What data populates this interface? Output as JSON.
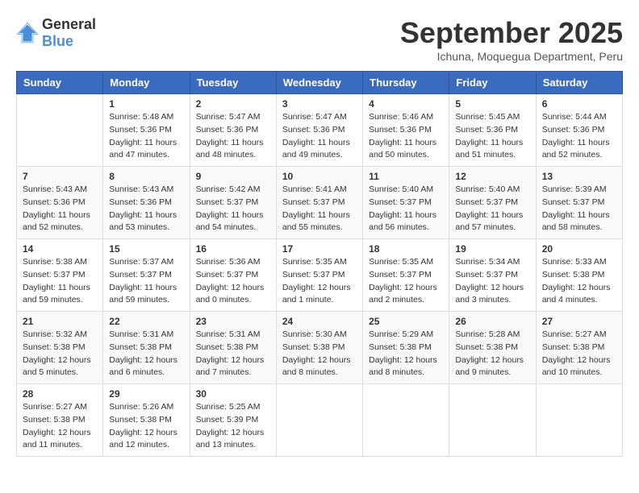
{
  "logo": {
    "general": "General",
    "blue": "Blue"
  },
  "title": {
    "month": "September 2025",
    "location": "Ichuna, Moquegua Department, Peru"
  },
  "weekdays": [
    "Sunday",
    "Monday",
    "Tuesday",
    "Wednesday",
    "Thursday",
    "Friday",
    "Saturday"
  ],
  "weeks": [
    [
      {
        "day": "",
        "sunrise": "",
        "sunset": "",
        "daylight": ""
      },
      {
        "day": "1",
        "sunrise": "Sunrise: 5:48 AM",
        "sunset": "Sunset: 5:36 PM",
        "daylight": "Daylight: 11 hours and 47 minutes."
      },
      {
        "day": "2",
        "sunrise": "Sunrise: 5:47 AM",
        "sunset": "Sunset: 5:36 PM",
        "daylight": "Daylight: 11 hours and 48 minutes."
      },
      {
        "day": "3",
        "sunrise": "Sunrise: 5:47 AM",
        "sunset": "Sunset: 5:36 PM",
        "daylight": "Daylight: 11 hours and 49 minutes."
      },
      {
        "day": "4",
        "sunrise": "Sunrise: 5:46 AM",
        "sunset": "Sunset: 5:36 PM",
        "daylight": "Daylight: 11 hours and 50 minutes."
      },
      {
        "day": "5",
        "sunrise": "Sunrise: 5:45 AM",
        "sunset": "Sunset: 5:36 PM",
        "daylight": "Daylight: 11 hours and 51 minutes."
      },
      {
        "day": "6",
        "sunrise": "Sunrise: 5:44 AM",
        "sunset": "Sunset: 5:36 PM",
        "daylight": "Daylight: 11 hours and 52 minutes."
      }
    ],
    [
      {
        "day": "7",
        "sunrise": "Sunrise: 5:43 AM",
        "sunset": "Sunset: 5:36 PM",
        "daylight": "Daylight: 11 hours and 52 minutes."
      },
      {
        "day": "8",
        "sunrise": "Sunrise: 5:43 AM",
        "sunset": "Sunset: 5:36 PM",
        "daylight": "Daylight: 11 hours and 53 minutes."
      },
      {
        "day": "9",
        "sunrise": "Sunrise: 5:42 AM",
        "sunset": "Sunset: 5:37 PM",
        "daylight": "Daylight: 11 hours and 54 minutes."
      },
      {
        "day": "10",
        "sunrise": "Sunrise: 5:41 AM",
        "sunset": "Sunset: 5:37 PM",
        "daylight": "Daylight: 11 hours and 55 minutes."
      },
      {
        "day": "11",
        "sunrise": "Sunrise: 5:40 AM",
        "sunset": "Sunset: 5:37 PM",
        "daylight": "Daylight: 11 hours and 56 minutes."
      },
      {
        "day": "12",
        "sunrise": "Sunrise: 5:40 AM",
        "sunset": "Sunset: 5:37 PM",
        "daylight": "Daylight: 11 hours and 57 minutes."
      },
      {
        "day": "13",
        "sunrise": "Sunrise: 5:39 AM",
        "sunset": "Sunset: 5:37 PM",
        "daylight": "Daylight: 11 hours and 58 minutes."
      }
    ],
    [
      {
        "day": "14",
        "sunrise": "Sunrise: 5:38 AM",
        "sunset": "Sunset: 5:37 PM",
        "daylight": "Daylight: 11 hours and 59 minutes."
      },
      {
        "day": "15",
        "sunrise": "Sunrise: 5:37 AM",
        "sunset": "Sunset: 5:37 PM",
        "daylight": "Daylight: 11 hours and 59 minutes."
      },
      {
        "day": "16",
        "sunrise": "Sunrise: 5:36 AM",
        "sunset": "Sunset: 5:37 PM",
        "daylight": "Daylight: 12 hours and 0 minutes."
      },
      {
        "day": "17",
        "sunrise": "Sunrise: 5:35 AM",
        "sunset": "Sunset: 5:37 PM",
        "daylight": "Daylight: 12 hours and 1 minute."
      },
      {
        "day": "18",
        "sunrise": "Sunrise: 5:35 AM",
        "sunset": "Sunset: 5:37 PM",
        "daylight": "Daylight: 12 hours and 2 minutes."
      },
      {
        "day": "19",
        "sunrise": "Sunrise: 5:34 AM",
        "sunset": "Sunset: 5:37 PM",
        "daylight": "Daylight: 12 hours and 3 minutes."
      },
      {
        "day": "20",
        "sunrise": "Sunrise: 5:33 AM",
        "sunset": "Sunset: 5:38 PM",
        "daylight": "Daylight: 12 hours and 4 minutes."
      }
    ],
    [
      {
        "day": "21",
        "sunrise": "Sunrise: 5:32 AM",
        "sunset": "Sunset: 5:38 PM",
        "daylight": "Daylight: 12 hours and 5 minutes."
      },
      {
        "day": "22",
        "sunrise": "Sunrise: 5:31 AM",
        "sunset": "Sunset: 5:38 PM",
        "daylight": "Daylight: 12 hours and 6 minutes."
      },
      {
        "day": "23",
        "sunrise": "Sunrise: 5:31 AM",
        "sunset": "Sunset: 5:38 PM",
        "daylight": "Daylight: 12 hours and 7 minutes."
      },
      {
        "day": "24",
        "sunrise": "Sunrise: 5:30 AM",
        "sunset": "Sunset: 5:38 PM",
        "daylight": "Daylight: 12 hours and 8 minutes."
      },
      {
        "day": "25",
        "sunrise": "Sunrise: 5:29 AM",
        "sunset": "Sunset: 5:38 PM",
        "daylight": "Daylight: 12 hours and 8 minutes."
      },
      {
        "day": "26",
        "sunrise": "Sunrise: 5:28 AM",
        "sunset": "Sunset: 5:38 PM",
        "daylight": "Daylight: 12 hours and 9 minutes."
      },
      {
        "day": "27",
        "sunrise": "Sunrise: 5:27 AM",
        "sunset": "Sunset: 5:38 PM",
        "daylight": "Daylight: 12 hours and 10 minutes."
      }
    ],
    [
      {
        "day": "28",
        "sunrise": "Sunrise: 5:27 AM",
        "sunset": "Sunset: 5:38 PM",
        "daylight": "Daylight: 12 hours and 11 minutes."
      },
      {
        "day": "29",
        "sunrise": "Sunrise: 5:26 AM",
        "sunset": "Sunset: 5:38 PM",
        "daylight": "Daylight: 12 hours and 12 minutes."
      },
      {
        "day": "30",
        "sunrise": "Sunrise: 5:25 AM",
        "sunset": "Sunset: 5:39 PM",
        "daylight": "Daylight: 12 hours and 13 minutes."
      },
      {
        "day": "",
        "sunrise": "",
        "sunset": "",
        "daylight": ""
      },
      {
        "day": "",
        "sunrise": "",
        "sunset": "",
        "daylight": ""
      },
      {
        "day": "",
        "sunrise": "",
        "sunset": "",
        "daylight": ""
      },
      {
        "day": "",
        "sunrise": "",
        "sunset": "",
        "daylight": ""
      }
    ]
  ]
}
